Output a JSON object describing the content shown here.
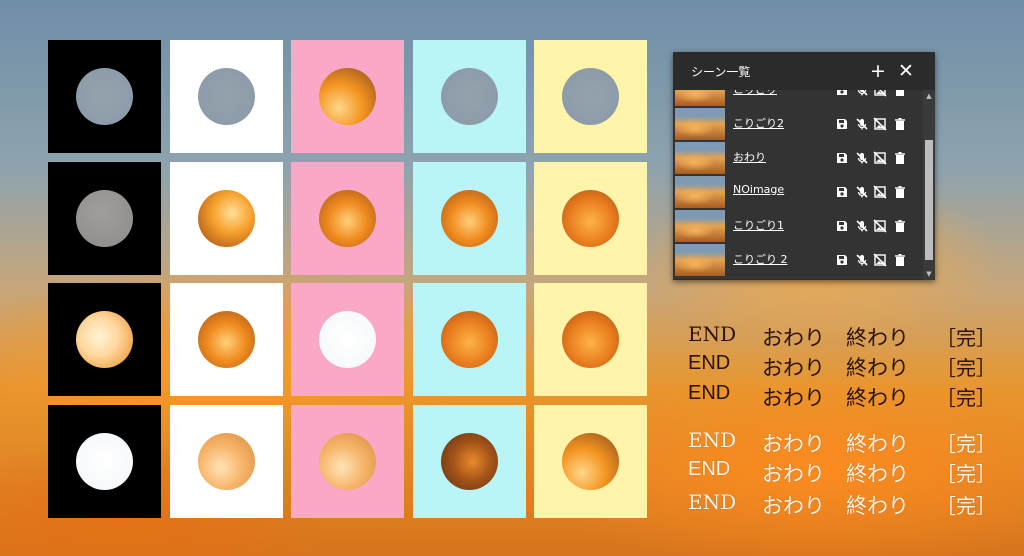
{
  "tiles": [
    [
      {
        "bg": "#000000",
        "hole": "h-blue"
      },
      {
        "bg": "#ffffff",
        "hole": "h-blue"
      },
      {
        "bg": "#f9a8c8",
        "hole": "h-fireA"
      },
      {
        "bg": "#b9f4f6",
        "hole": "h-blue"
      },
      {
        "bg": "#fff4a9",
        "hole": "h-blue"
      }
    ],
    [
      {
        "bg": "#000000",
        "hole": "h-grey"
      },
      {
        "bg": "#ffffff",
        "hole": "h-fireB"
      },
      {
        "bg": "#f9a8c8",
        "hole": "h-fireE"
      },
      {
        "bg": "#b9f4f6",
        "hole": "h-fireE"
      },
      {
        "bg": "#fff4a9",
        "hole": "h-fireD"
      }
    ],
    [
      {
        "bg": "#000000",
        "hole": "h-fireC"
      },
      {
        "bg": "#ffffff",
        "hole": "h-fireE"
      },
      {
        "bg": "#f9a8c8",
        "hole": "h-white"
      },
      {
        "bg": "#b9f4f6",
        "hole": "h-fireD"
      },
      {
        "bg": "#fff4a9",
        "hole": "h-fireD"
      }
    ],
    [
      {
        "bg": "#000000",
        "hole": "h-white"
      },
      {
        "bg": "#ffffff",
        "hole": "h-paleF"
      },
      {
        "bg": "#f9a8c8",
        "hole": "h-paleF"
      },
      {
        "bg": "#b9f4f6",
        "hole": "h-darkF"
      },
      {
        "bg": "#fff4a9",
        "hole": "h-fireA"
      }
    ]
  ],
  "panel": {
    "title": "シーン一覧",
    "add_icon": "plus-icon",
    "close_icon": "close-icon",
    "scenes": [
      {
        "name": "こりごり"
      },
      {
        "name": "こりごり2"
      },
      {
        "name": "おわり"
      },
      {
        "name": "NOimage"
      },
      {
        "name": "こりごり1"
      },
      {
        "name": "こりごり 2"
      }
    ],
    "row_icons": [
      "save-icon",
      "no-mic-icon",
      "no-image-icon",
      "trash-icon"
    ]
  },
  "samples": {
    "dark": [
      [
        "END",
        "おわり",
        "終わり",
        "［完］"
      ],
      [
        "END",
        "おわり",
        "終わり",
        "［完］"
      ],
      [
        "END",
        "おわり",
        "終わり",
        "［完］"
      ]
    ],
    "light": [
      [
        "END",
        "おわり",
        "終わり",
        "［完］"
      ],
      [
        "END",
        "おわり",
        "終わり",
        "［完］"
      ],
      [
        "END",
        "おわり",
        "終わり",
        "［完］"
      ]
    ]
  }
}
